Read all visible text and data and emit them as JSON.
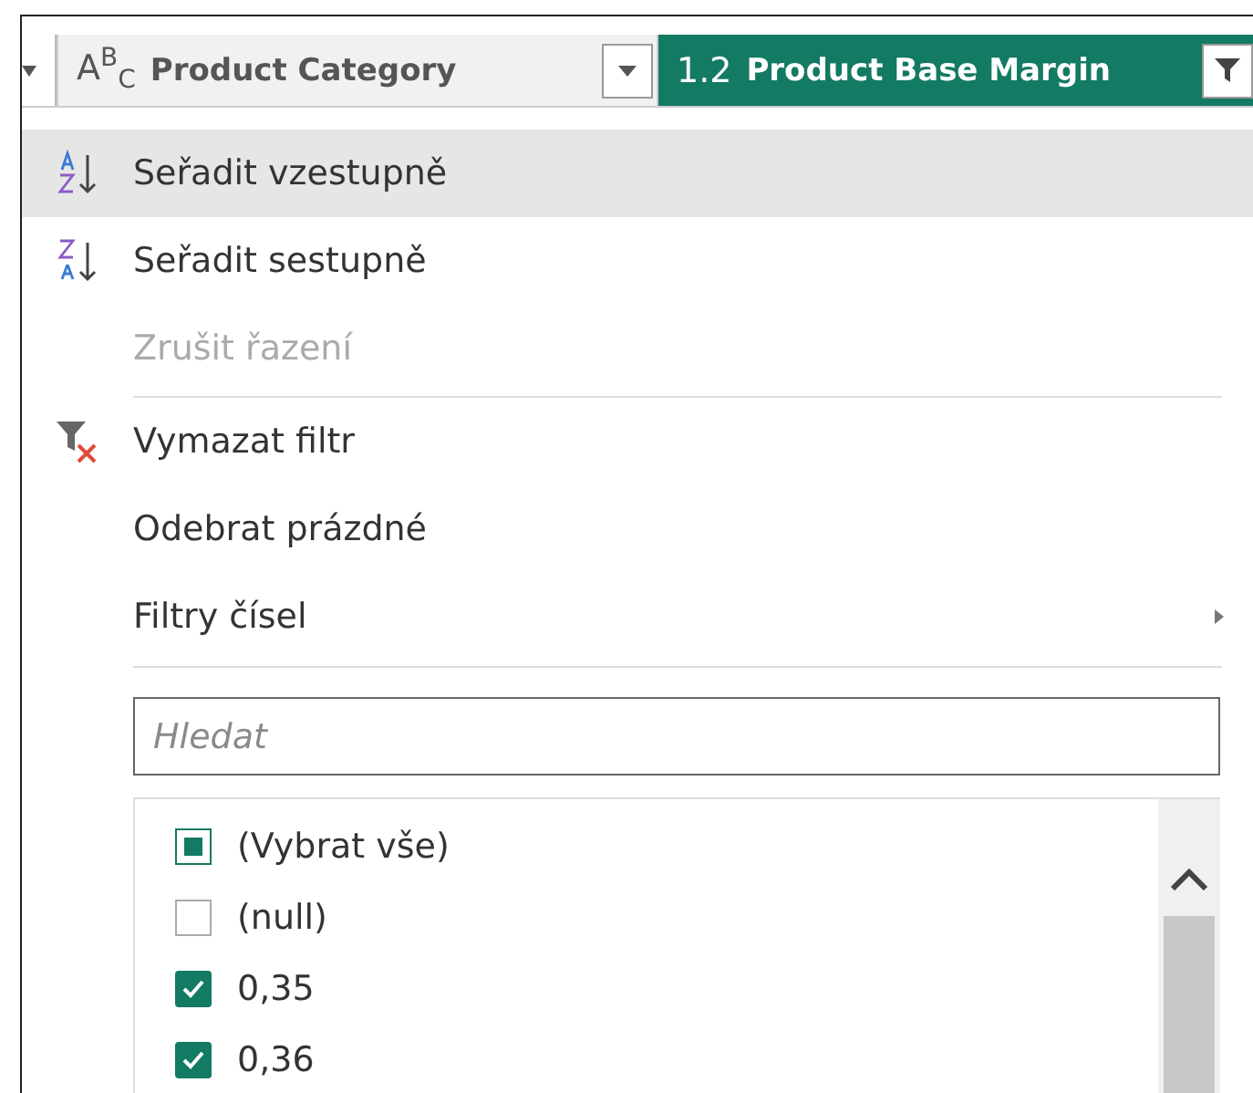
{
  "header": {
    "columns": [
      {
        "badge": "A$^{B}$$_{C}$",
        "label": "Product Category",
        "active": false,
        "filtered": false
      },
      {
        "badge": "1.2",
        "label": "Product Base Margin",
        "active": true,
        "filtered": true
      }
    ]
  },
  "menu": [
    {
      "kind": "sort-asc",
      "label": "Seřadit vzestupně",
      "highlighted": true,
      "disabled": false,
      "submenu": false
    },
    {
      "kind": "sort-desc",
      "label": "Seřadit sestupně",
      "highlighted": false,
      "disabled": false,
      "submenu": false
    },
    {
      "kind": "plain",
      "label": "Zrušit řazení",
      "highlighted": false,
      "disabled": true,
      "submenu": false
    },
    {
      "kind": "separator"
    },
    {
      "kind": "clear-filter",
      "label": "Vymazat filtr",
      "highlighted": false,
      "disabled": false,
      "submenu": false
    },
    {
      "kind": "plain",
      "label": "Odebrat prázdné",
      "highlighted": false,
      "disabled": false,
      "submenu": false
    },
    {
      "kind": "plain",
      "label": "Filtry čísel",
      "highlighted": false,
      "disabled": false,
      "submenu": true
    },
    {
      "kind": "separator"
    }
  ],
  "search": {
    "placeholder": "Hledat"
  },
  "values": [
    {
      "label": "(Vybrat vše)",
      "partial": true
    },
    {
      "label": "(null)",
      "checked": false
    },
    {
      "label": "0,35",
      "checked": true
    },
    {
      "label": "0,36",
      "checked": true
    }
  ]
}
